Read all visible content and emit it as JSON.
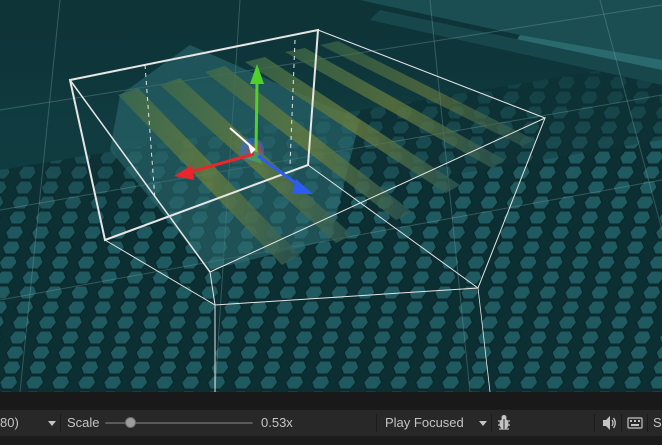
{
  "toolbar": {
    "resolution_partial": "80)",
    "scale_label": "Scale",
    "scale_value": "0.53x",
    "scale_fraction": 0.17,
    "play_mode": "Play Focused",
    "bug_icon": "bug-icon",
    "audio_icon": "speaker-icon",
    "keyboard_icon": "keyboard-icon",
    "stats_partial": "S"
  },
  "colors": {
    "ground": "#114247",
    "hex_tile": "#1f5a60",
    "gizmo_x": "#e8262b",
    "gizmo_y": "#4fd12a",
    "gizmo_z": "#2c5cf2",
    "bounds": "#e6e6e6",
    "toolbar_bg": "#282828"
  }
}
